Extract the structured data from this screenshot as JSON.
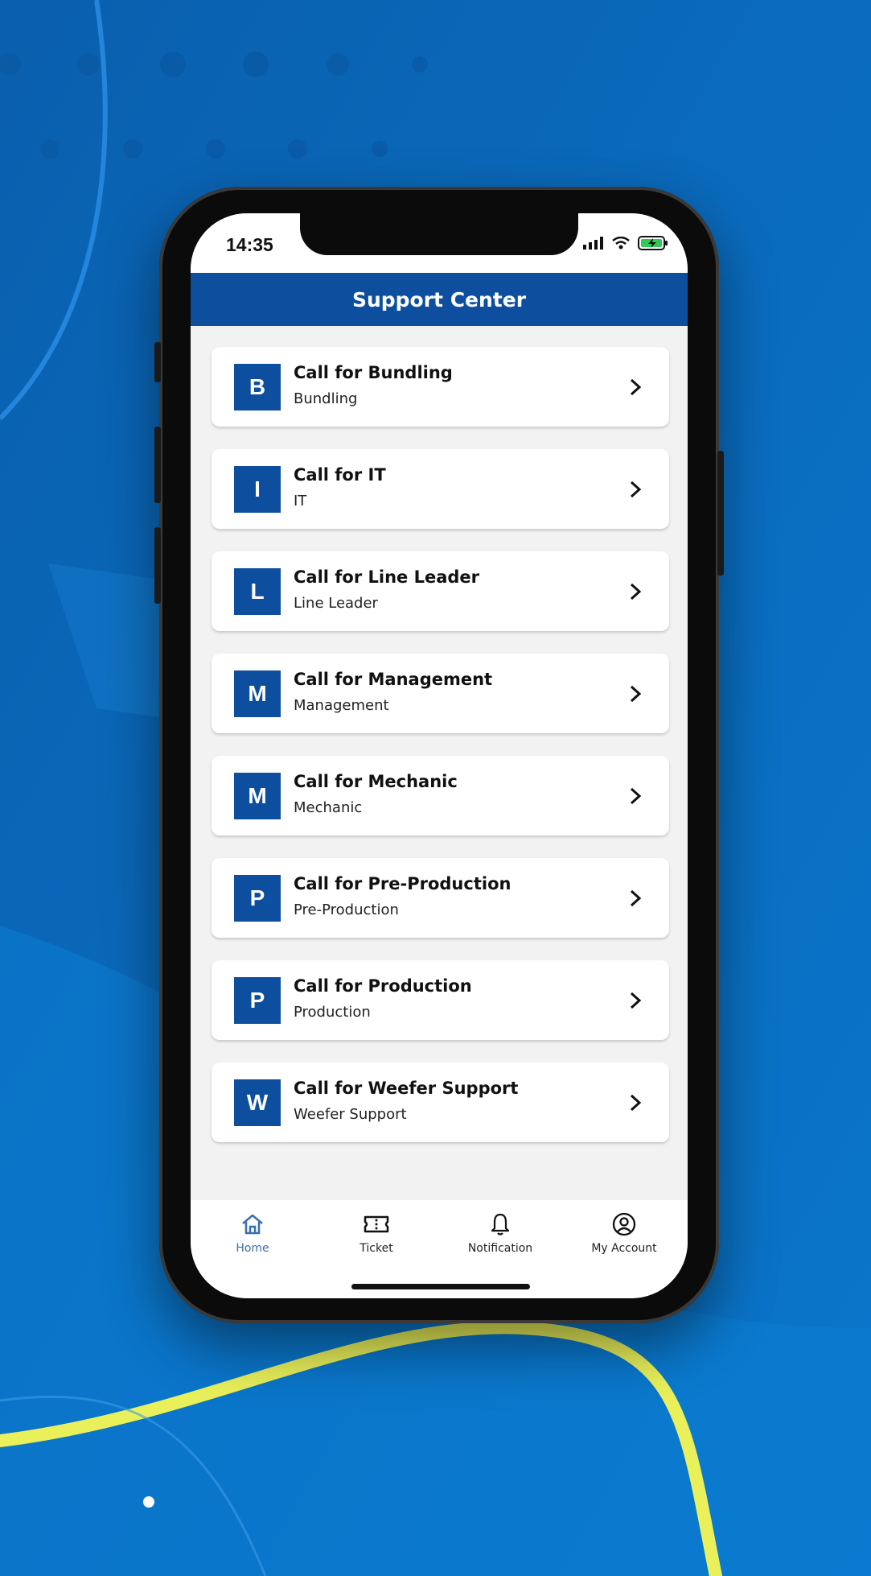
{
  "status_bar": {
    "time": "14:35"
  },
  "header": {
    "title": "Support Center"
  },
  "items": [
    {
      "badge": "B",
      "title": "Call for Bundling",
      "subtitle": "Bundling"
    },
    {
      "badge": "I",
      "title": "Call for IT",
      "subtitle": "IT"
    },
    {
      "badge": "L",
      "title": "Call for Line Leader",
      "subtitle": "Line Leader"
    },
    {
      "badge": "M",
      "title": "Call for Management",
      "subtitle": "Management"
    },
    {
      "badge": "M",
      "title": "Call for Mechanic",
      "subtitle": "Mechanic"
    },
    {
      "badge": "P",
      "title": "Call for Pre-Production",
      "subtitle": "Pre-Production"
    },
    {
      "badge": "P",
      "title": "Call for Production",
      "subtitle": "Production"
    },
    {
      "badge": "W",
      "title": "Call for Weefer Support",
      "subtitle": "Weefer Support"
    }
  ],
  "bottom_nav": [
    {
      "label": "Home",
      "icon": "home-icon",
      "active": true
    },
    {
      "label": "Ticket",
      "icon": "ticket-icon",
      "active": false
    },
    {
      "label": "Notification",
      "icon": "bell-icon",
      "active": false
    },
    {
      "label": "My Account",
      "icon": "account-icon",
      "active": false
    }
  ],
  "colors": {
    "primary": "#0d4f9e",
    "background": "#0a6cbf",
    "accent_wave": "#e9f05a",
    "active_nav": "#3a6fae"
  }
}
